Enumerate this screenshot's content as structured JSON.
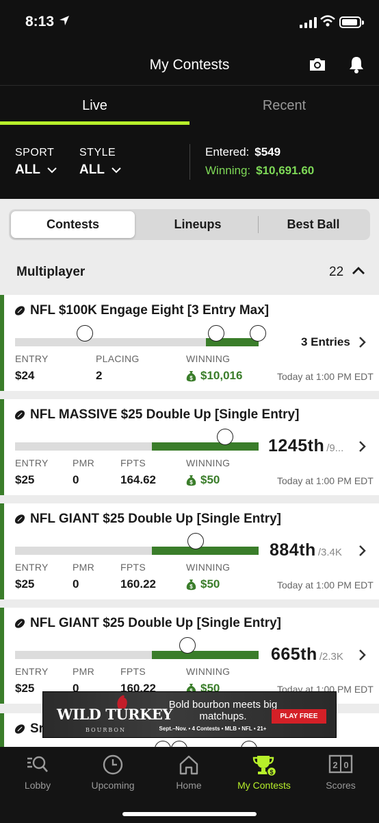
{
  "status_bar": {
    "time": "8:13"
  },
  "header": {
    "title": "My Contests"
  },
  "tabs": [
    {
      "label": "Live",
      "active": true
    },
    {
      "label": "Recent",
      "active": false
    }
  ],
  "filters": {
    "sport_label": "SPORT",
    "sport_value": "ALL",
    "style_label": "STYLE",
    "style_value": "ALL",
    "entered_label": "Entered:",
    "entered_value": "$549",
    "winning_label": "Winning:",
    "winning_value": "$10,691.60"
  },
  "segments": [
    {
      "label": "Contests",
      "active": true
    },
    {
      "label": "Lineups",
      "active": false
    },
    {
      "label": "Best Ball",
      "active": false
    }
  ],
  "section": {
    "name": "Multiplayer",
    "count": "22"
  },
  "contests": [
    {
      "title": "NFL $100K Engage Eight [3 Entry Max]",
      "entries": "3 Entries",
      "col1_label": "ENTRY",
      "col1_value": "$24",
      "col2_label": "PLACING",
      "col2_value": "2",
      "winning_label": "WINNING",
      "winning_value": "$10,016",
      "time": "Today at 1:00 PM EDT"
    },
    {
      "title": "NFL MASSIVE $25 Double Up [Single Entry]",
      "rank": "1245th",
      "rank_of": "/9...",
      "col1_label": "ENTRY",
      "col1_value": "$25",
      "col2_label": "PMR",
      "col2_value": "0",
      "col3_label": "FPTS",
      "col3_value": "164.62",
      "winning_label": "WINNING",
      "winning_value": "$50",
      "time": "Today at 1:00 PM EDT"
    },
    {
      "title": "NFL GIANT $25 Double Up [Single Entry]",
      "rank": "884th",
      "rank_of": "/3.4K",
      "col1_label": "ENTRY",
      "col1_value": "$25",
      "col2_label": "PMR",
      "col2_value": "0",
      "col3_label": "FPTS",
      "col3_value": "160.22",
      "winning_label": "WINNING",
      "winning_value": "$50",
      "time": "Today at 1:00 PM EDT"
    },
    {
      "title": "NFL GIANT $25 Double Up [Single Entry]",
      "rank": "665th",
      "rank_of": "/2.3K",
      "col1_label": "ENTRY",
      "col1_value": "$25",
      "col2_label": "PMR",
      "col2_value": "0",
      "col3_label": "FPTS",
      "col3_value": "160.22",
      "winning_label": "WINNING",
      "winning_value": "$50",
      "time": "Today at 1:00 PM EDT"
    },
    {
      "title": "Sr"
    }
  ],
  "ad": {
    "brand": "WILD TURKEY",
    "brand_sub": "BOURBON",
    "headline": "Bold bourbon meets big matchups.",
    "details": "Sept.–Nov. • 4 Contests • MLB • NFL • 21+",
    "cta": "PLAY FREE"
  },
  "bottom_nav": [
    {
      "label": "Lobby",
      "icon": "search-list-icon"
    },
    {
      "label": "Upcoming",
      "icon": "clock-icon"
    },
    {
      "label": "Home",
      "icon": "home-icon"
    },
    {
      "label": "My Contests",
      "icon": "trophy-icon",
      "active": true
    },
    {
      "label": "Scores",
      "icon": "scoreboard-icon"
    }
  ],
  "colors": {
    "accent": "#b7f02a",
    "win_green": "#3a7d2a",
    "winning_text": "#7ed957",
    "header_bg": "#111111"
  }
}
